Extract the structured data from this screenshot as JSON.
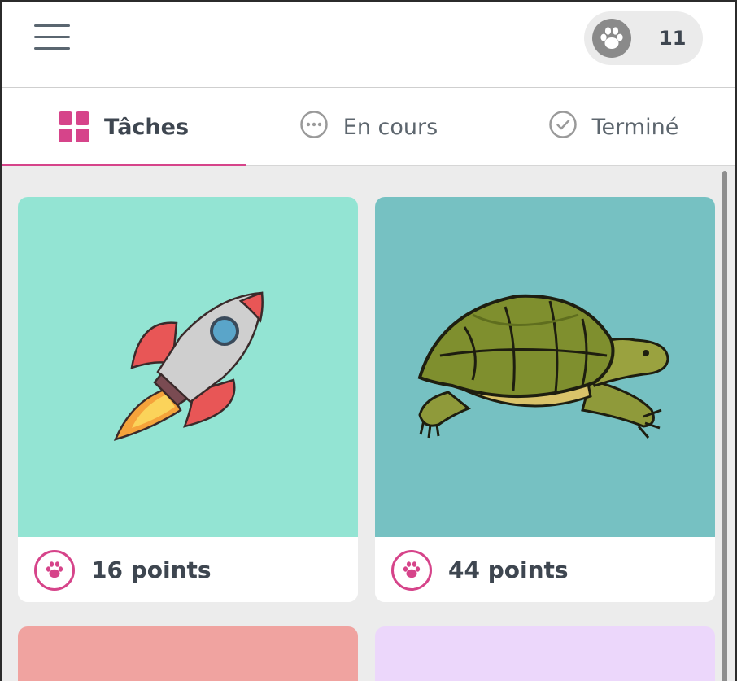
{
  "header": {
    "menu_icon": "hamburger-menu-icon",
    "points_icon": "paw-icon",
    "points_total": "11"
  },
  "tabs": [
    {
      "label": "Tâches",
      "icon": "grid-icon",
      "active": true
    },
    {
      "label": "En cours",
      "icon": "ellipsis-circle-icon",
      "active": false
    },
    {
      "label": "Terminé",
      "icon": "check-circle-icon",
      "active": false
    }
  ],
  "colors": {
    "accent": "#d6448a",
    "card_rocket_bg": "#93e4d3",
    "card_turtle_bg": "#76c1c2",
    "card_salmon_bg": "#f0a3a0",
    "card_lilac_bg": "#ecd7fb"
  },
  "tasks": [
    {
      "image": "rocket",
      "points_label": "16 points",
      "badge_icon": "paw-icon"
    },
    {
      "image": "turtle",
      "points_label": "44 points",
      "badge_icon": "paw-icon"
    },
    {
      "image": "",
      "points_label": "",
      "badge_icon": ""
    },
    {
      "image": "",
      "points_label": "",
      "badge_icon": ""
    }
  ]
}
